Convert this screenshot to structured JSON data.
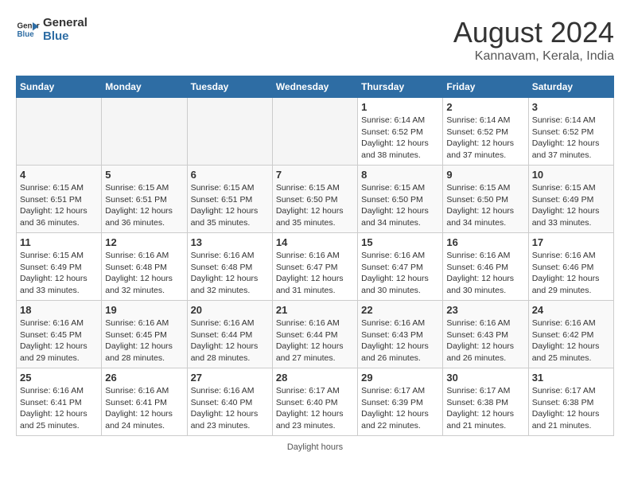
{
  "logo": {
    "line1": "General",
    "line2": "Blue"
  },
  "title": "August 2024",
  "subtitle": "Kannavam, Kerala, India",
  "days_of_week": [
    "Sunday",
    "Monday",
    "Tuesday",
    "Wednesday",
    "Thursday",
    "Friday",
    "Saturday"
  ],
  "weeks": [
    [
      {
        "num": "",
        "info": ""
      },
      {
        "num": "",
        "info": ""
      },
      {
        "num": "",
        "info": ""
      },
      {
        "num": "",
        "info": ""
      },
      {
        "num": "1",
        "info": "Sunrise: 6:14 AM\nSunset: 6:52 PM\nDaylight: 12 hours\nand 38 minutes."
      },
      {
        "num": "2",
        "info": "Sunrise: 6:14 AM\nSunset: 6:52 PM\nDaylight: 12 hours\nand 37 minutes."
      },
      {
        "num": "3",
        "info": "Sunrise: 6:14 AM\nSunset: 6:52 PM\nDaylight: 12 hours\nand 37 minutes."
      }
    ],
    [
      {
        "num": "4",
        "info": "Sunrise: 6:15 AM\nSunset: 6:51 PM\nDaylight: 12 hours\nand 36 minutes."
      },
      {
        "num": "5",
        "info": "Sunrise: 6:15 AM\nSunset: 6:51 PM\nDaylight: 12 hours\nand 36 minutes."
      },
      {
        "num": "6",
        "info": "Sunrise: 6:15 AM\nSunset: 6:51 PM\nDaylight: 12 hours\nand 35 minutes."
      },
      {
        "num": "7",
        "info": "Sunrise: 6:15 AM\nSunset: 6:50 PM\nDaylight: 12 hours\nand 35 minutes."
      },
      {
        "num": "8",
        "info": "Sunrise: 6:15 AM\nSunset: 6:50 PM\nDaylight: 12 hours\nand 34 minutes."
      },
      {
        "num": "9",
        "info": "Sunrise: 6:15 AM\nSunset: 6:50 PM\nDaylight: 12 hours\nand 34 minutes."
      },
      {
        "num": "10",
        "info": "Sunrise: 6:15 AM\nSunset: 6:49 PM\nDaylight: 12 hours\nand 33 minutes."
      }
    ],
    [
      {
        "num": "11",
        "info": "Sunrise: 6:15 AM\nSunset: 6:49 PM\nDaylight: 12 hours\nand 33 minutes."
      },
      {
        "num": "12",
        "info": "Sunrise: 6:16 AM\nSunset: 6:48 PM\nDaylight: 12 hours\nand 32 minutes."
      },
      {
        "num": "13",
        "info": "Sunrise: 6:16 AM\nSunset: 6:48 PM\nDaylight: 12 hours\nand 32 minutes."
      },
      {
        "num": "14",
        "info": "Sunrise: 6:16 AM\nSunset: 6:47 PM\nDaylight: 12 hours\nand 31 minutes."
      },
      {
        "num": "15",
        "info": "Sunrise: 6:16 AM\nSunset: 6:47 PM\nDaylight: 12 hours\nand 30 minutes."
      },
      {
        "num": "16",
        "info": "Sunrise: 6:16 AM\nSunset: 6:46 PM\nDaylight: 12 hours\nand 30 minutes."
      },
      {
        "num": "17",
        "info": "Sunrise: 6:16 AM\nSunset: 6:46 PM\nDaylight: 12 hours\nand 29 minutes."
      }
    ],
    [
      {
        "num": "18",
        "info": "Sunrise: 6:16 AM\nSunset: 6:45 PM\nDaylight: 12 hours\nand 29 minutes."
      },
      {
        "num": "19",
        "info": "Sunrise: 6:16 AM\nSunset: 6:45 PM\nDaylight: 12 hours\nand 28 minutes."
      },
      {
        "num": "20",
        "info": "Sunrise: 6:16 AM\nSunset: 6:44 PM\nDaylight: 12 hours\nand 28 minutes."
      },
      {
        "num": "21",
        "info": "Sunrise: 6:16 AM\nSunset: 6:44 PM\nDaylight: 12 hours\nand 27 minutes."
      },
      {
        "num": "22",
        "info": "Sunrise: 6:16 AM\nSunset: 6:43 PM\nDaylight: 12 hours\nand 26 minutes."
      },
      {
        "num": "23",
        "info": "Sunrise: 6:16 AM\nSunset: 6:43 PM\nDaylight: 12 hours\nand 26 minutes."
      },
      {
        "num": "24",
        "info": "Sunrise: 6:16 AM\nSunset: 6:42 PM\nDaylight: 12 hours\nand 25 minutes."
      }
    ],
    [
      {
        "num": "25",
        "info": "Sunrise: 6:16 AM\nSunset: 6:41 PM\nDaylight: 12 hours\nand 25 minutes."
      },
      {
        "num": "26",
        "info": "Sunrise: 6:16 AM\nSunset: 6:41 PM\nDaylight: 12 hours\nand 24 minutes."
      },
      {
        "num": "27",
        "info": "Sunrise: 6:16 AM\nSunset: 6:40 PM\nDaylight: 12 hours\nand 23 minutes."
      },
      {
        "num": "28",
        "info": "Sunrise: 6:17 AM\nSunset: 6:40 PM\nDaylight: 12 hours\nand 23 minutes."
      },
      {
        "num": "29",
        "info": "Sunrise: 6:17 AM\nSunset: 6:39 PM\nDaylight: 12 hours\nand 22 minutes."
      },
      {
        "num": "30",
        "info": "Sunrise: 6:17 AM\nSunset: 6:38 PM\nDaylight: 12 hours\nand 21 minutes."
      },
      {
        "num": "31",
        "info": "Sunrise: 6:17 AM\nSunset: 6:38 PM\nDaylight: 12 hours\nand 21 minutes."
      }
    ]
  ],
  "footer": "Daylight hours"
}
